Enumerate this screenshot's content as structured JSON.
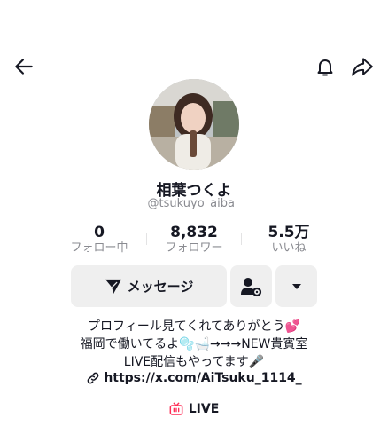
{
  "header": {
    "back_icon": "arrow-left-icon",
    "bell_icon": "bell-icon",
    "share_icon": "share-arrow-icon"
  },
  "profile": {
    "display_name": "相葉つくよ",
    "username": "@tsukuyo_aiba_"
  },
  "stats": [
    {
      "value": "0",
      "label": "フォロー中"
    },
    {
      "value": "8,832",
      "label": "フォロワー"
    },
    {
      "value": "5.5万",
      "label": "いいね"
    }
  ],
  "actions": {
    "message_label": "メッセージ",
    "message_icon": "send-icon",
    "user_settings_icon": "user-settings-icon",
    "more_icon": "caret-down-icon"
  },
  "bio": {
    "line1": "プロフィール見てくれてありがとう💕",
    "line2": "福岡で働いてるよ🫧🛁→→→NEW貴賓室",
    "line3": "LIVE配信もやってます🎤",
    "link": "https://x.com/AiTsuku_1114_"
  },
  "live": {
    "label": "LIVE",
    "color": "#fe2c55"
  }
}
